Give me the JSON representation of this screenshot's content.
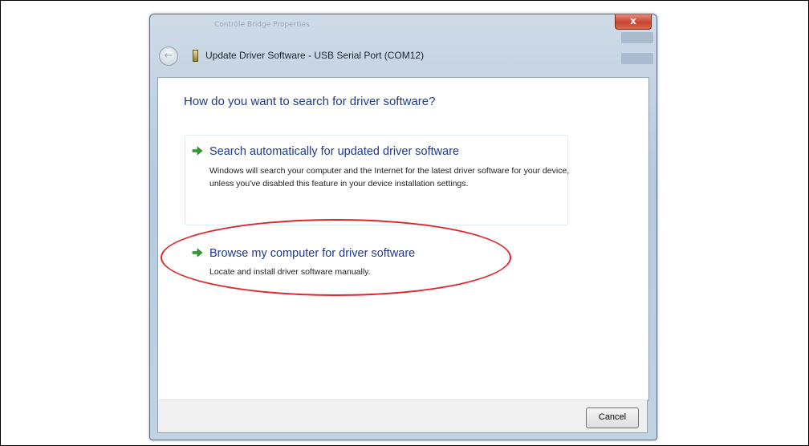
{
  "window": {
    "title": "Update Driver Software - USB Serial Port (COM12)",
    "ghost_title": "Contrôle Bridge Properties",
    "close_glyph": "x"
  },
  "dialog": {
    "heading": "How do you want to search for driver software?",
    "options": [
      {
        "title": "Search automatically for updated driver software",
        "description": "Windows will search your computer and the Internet for the latest driver software for your device, unless you've disabled this feature in your device installation settings."
      },
      {
        "title": "Browse my computer for driver software",
        "description": "Locate and install driver software manually."
      }
    ]
  },
  "footer": {
    "cancel_label": "Cancel"
  },
  "icons": {
    "back": "back-arrow-icon",
    "device": "usb-device-icon",
    "option_arrow": "green-arrow-icon"
  },
  "colors": {
    "heading": "#1f3a8a",
    "arrow": "#2f9e2f",
    "highlight": "#e0242a",
    "close_button": "#c8442f"
  }
}
